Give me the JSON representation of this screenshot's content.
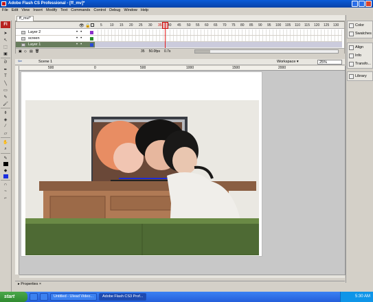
{
  "window": {
    "title": "Adobe Flash CS Professional - [ff_mv]*"
  },
  "menu": [
    "File",
    "Edit",
    "View",
    "Insert",
    "Modify",
    "Text",
    "Commands",
    "Control",
    "Debug",
    "Window",
    "Help"
  ],
  "document": {
    "tab": "ff_mvi*"
  },
  "timeline": {
    "frame_numbers": [
      "5",
      "10",
      "15",
      "20",
      "25",
      "30",
      "35",
      "40",
      "45",
      "50",
      "55",
      "60",
      "65",
      "70",
      "75",
      "80",
      "85",
      "90",
      "95",
      "100",
      "105",
      "110",
      "115",
      "120",
      "125",
      "130",
      "135"
    ],
    "layers": [
      {
        "name": "Layer 2",
        "color": "#8b2fc9"
      },
      {
        "name": "screen",
        "color": "#2a8c2a"
      },
      {
        "name": "Layer 1",
        "color": "#2a4bd6"
      }
    ],
    "current_frame": "35",
    "fps": "50.0fps",
    "elapsed": "0.7s"
  },
  "editbar": {
    "scene": "Scene 1",
    "workspace": "Workspace ▾",
    "zoom": "25%"
  },
  "rulers": {
    "marks": [
      "500",
      "0",
      "500",
      "1000",
      "1500",
      "2000"
    ]
  },
  "properties": {
    "label": "▸ Properties ×"
  },
  "right_panels": {
    "group1": [
      "Color",
      "Swatches"
    ],
    "group2": [
      "Align",
      "Info",
      "Transfo..."
    ],
    "group3": [
      "Library"
    ]
  },
  "taskbar": {
    "start": "start",
    "items": [
      "Untitled - Ulead Video...",
      "Adobe Flash CS3 Prof..."
    ],
    "time": "5:30 AM"
  },
  "colors": {
    "selected_layer": "#687d5d",
    "playhead": "#e21b1b",
    "title_blue": "#0a5bd8",
    "logo_red": "#b7221f"
  }
}
